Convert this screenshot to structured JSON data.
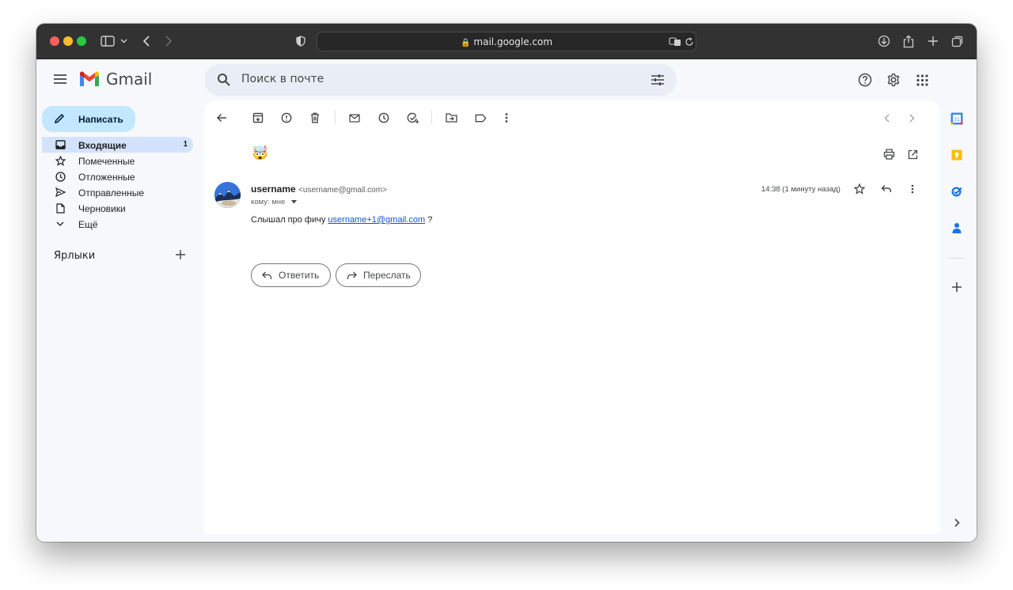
{
  "browser": {
    "url": "mail.google.com"
  },
  "app": {
    "name": "Gmail",
    "search_placeholder": "Поиск в почте"
  },
  "sidebar": {
    "compose_label": "Написать",
    "items": [
      {
        "label": "Входящие",
        "count": "1",
        "icon": "inbox-icon",
        "active": true
      },
      {
        "label": "Помеченные",
        "icon": "star-icon"
      },
      {
        "label": "Отложенные",
        "icon": "clock-icon"
      },
      {
        "label": "Отправленные",
        "icon": "send-icon"
      },
      {
        "label": "Черновики",
        "icon": "draft-icon"
      },
      {
        "label": "Ещё",
        "icon": "chevron-down-icon"
      }
    ],
    "labels_title": "Ярлыки"
  },
  "message": {
    "subject": "🤯",
    "sender_name": "username",
    "sender_email": "<username@gmail.com>",
    "to_line": "кому: мне",
    "timestamp": "14:38 (1 минуту назад)",
    "body_prefix": "Слышал про фичу",
    "body_link": "username+1@gmail.com",
    "body_suffix": "?",
    "reply_label": "Ответить",
    "forward_label": "Переслать"
  },
  "colors": {
    "compose_bg": "#c2e7ff",
    "active_nav_bg": "#d3e3fd",
    "search_bg": "#e9eef6",
    "link": "#1155cc"
  }
}
